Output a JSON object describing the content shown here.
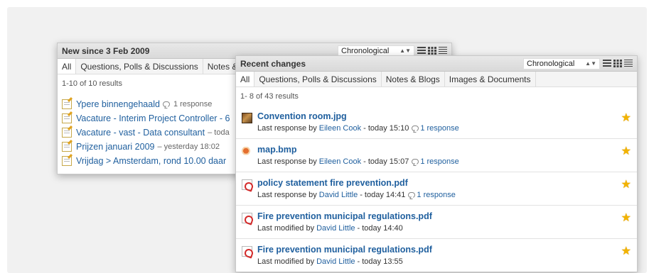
{
  "back_panel": {
    "title": "New since 3 Feb 2009",
    "sort_value": "Chronological",
    "tabs": [
      "All",
      "Questions, Polls & Discussions",
      "Notes &"
    ],
    "results": "1-10 of 10 results",
    "items": [
      {
        "title": "Ypere binnengehaald",
        "meta": "1 response",
        "has_bubble": true
      },
      {
        "title": "Vacature - Interim Project Controller - 6",
        "meta": "",
        "has_bubble": false
      },
      {
        "title": "Vacature - vast - Data consultant",
        "meta": "– toda",
        "has_bubble": false
      },
      {
        "title": "Prijzen januari 2009",
        "meta": "– yesterday 18:02",
        "has_bubble": false
      },
      {
        "title": "Vrijdag > Amsterdam, rond 10.00 daar",
        "meta": "",
        "has_bubble": false
      }
    ]
  },
  "front_panel": {
    "title": "Recent changes",
    "sort_value": "Chronological",
    "tabs": [
      "All",
      "Questions, Polls & Discussions",
      "Notes & Blogs",
      "Images & Documents"
    ],
    "results": "1- 8 of 43 results",
    "items": [
      {
        "icon": "photo-icon",
        "title": "Convention room.jpg",
        "action": "Last response by",
        "user": "Eileen Cook",
        "time": "- today 15:10",
        "response": "1 response"
      },
      {
        "icon": "bmp-icon",
        "title": "map.bmp",
        "action": "Last response by",
        "user": "Eileen Cook",
        "time": "- today 15:07",
        "response": "1 response"
      },
      {
        "icon": "pdf-icon",
        "title": "policy statement fire prevention.pdf",
        "action": "Last response by",
        "user": "David Little",
        "time": "- today 14:41",
        "response": "1 response"
      },
      {
        "icon": "pdf-icon",
        "title": "Fire prevention municipal regulations.pdf",
        "action": "Last modified by",
        "user": "David Little",
        "time": "- today 14:40",
        "response": ""
      },
      {
        "icon": "pdf-icon",
        "title": "Fire prevention municipal regulations.pdf",
        "action": "Last modified by",
        "user": "David Little",
        "time": "- today 13:55",
        "response": ""
      }
    ]
  },
  "colors": {
    "link": "#1f5f9e",
    "star": "#f2b300"
  }
}
